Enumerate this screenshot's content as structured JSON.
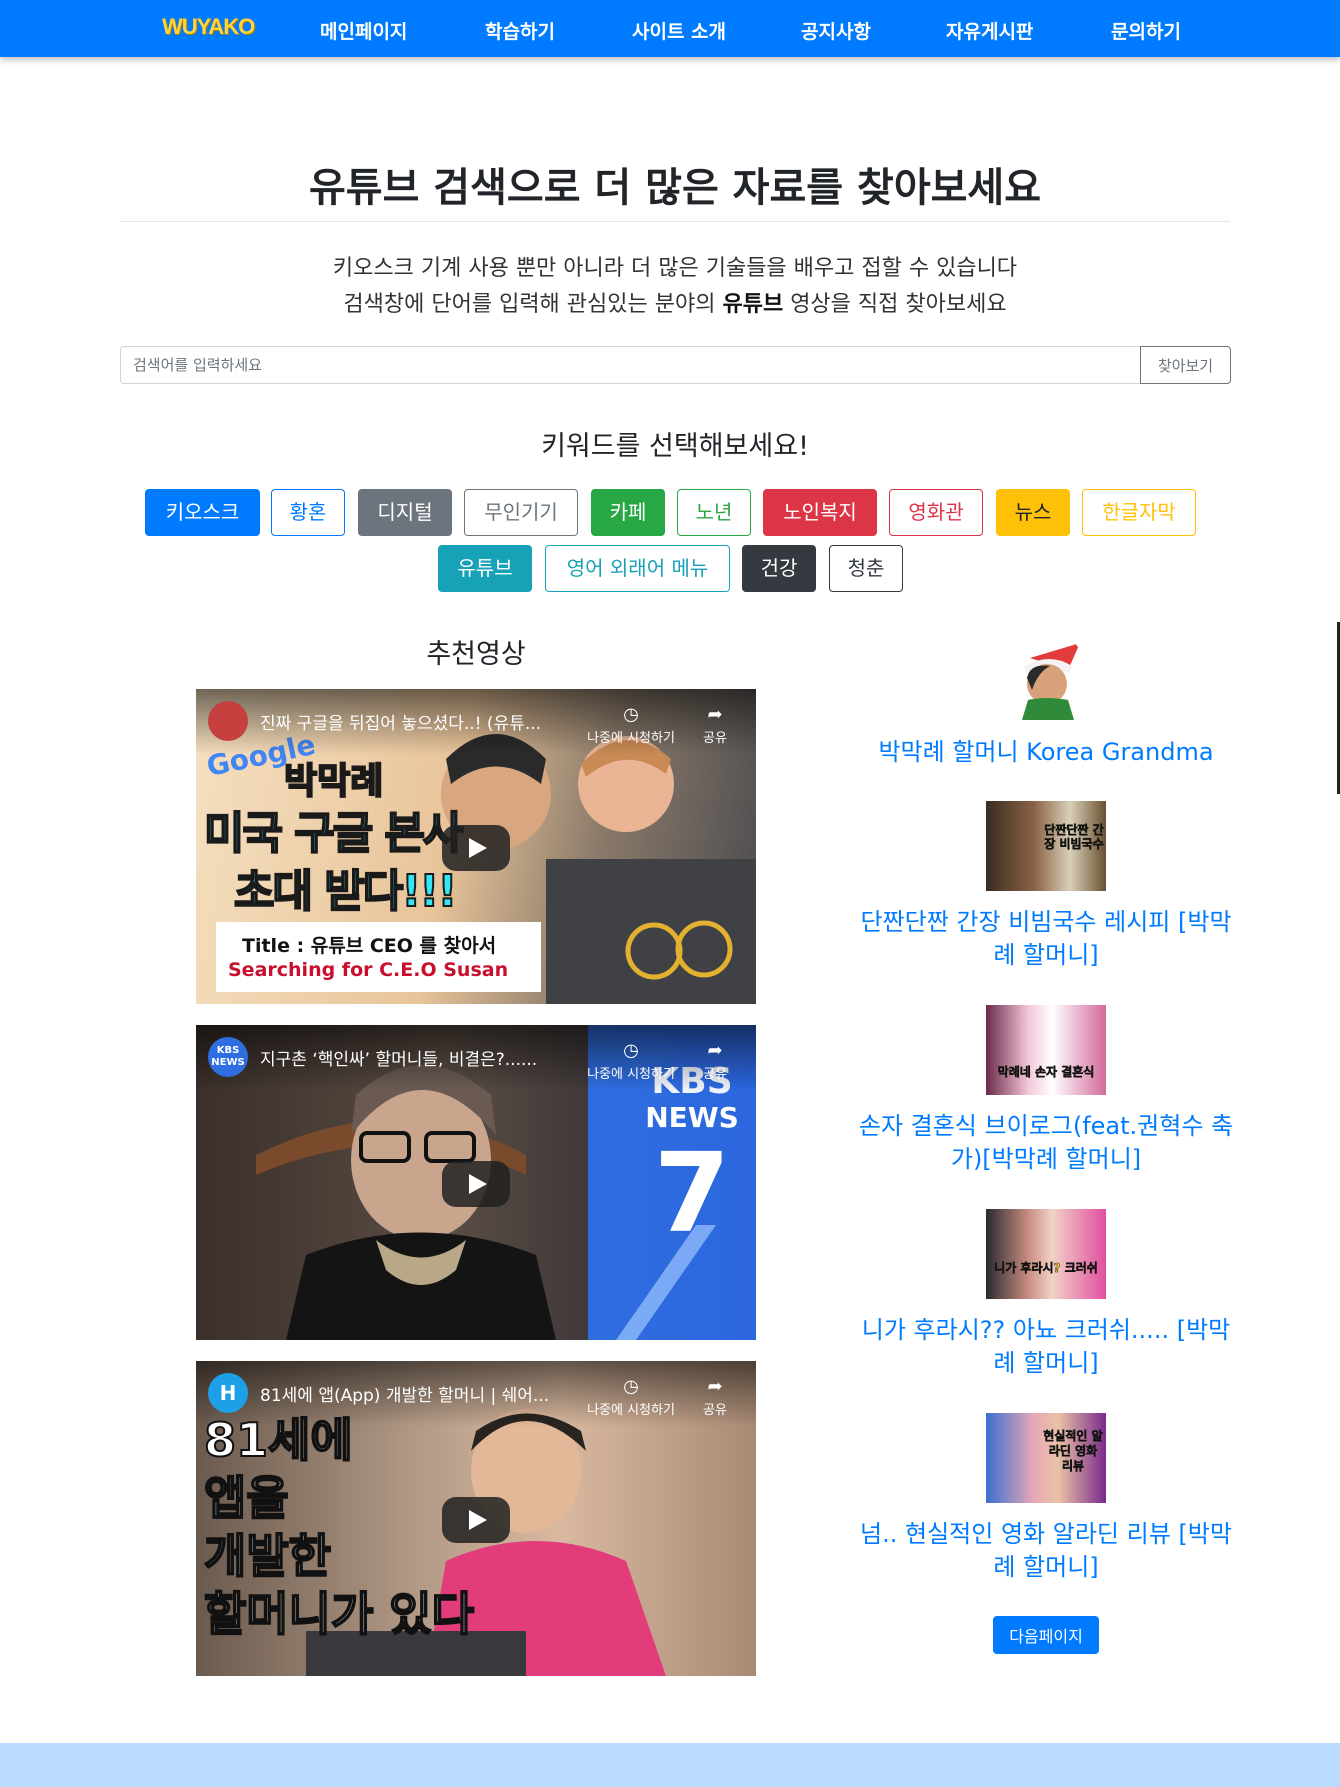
{
  "nav": {
    "brand": "WUYAKO",
    "items": [
      "메인페이지",
      "학습하기",
      "사이트 소개",
      "공지사항",
      "자유게시판",
      "문의하기"
    ]
  },
  "hero": {
    "title": "유튜브 검색으로 더 많은 자료를 찾아보세요",
    "line1": "키오스크 기계 사용 뿐만 아니라 더 많은 기술들을 배우고 접할 수 있습니다",
    "line2_before": "검색창에 단어를 입력해 관심있는 분야의 ",
    "line2_bold": "유튜브",
    "line2_after": " 영상을 직접 찾아보세요"
  },
  "search": {
    "placeholder": "검색어를 입력하세요",
    "value": "",
    "button": "찾아보기"
  },
  "keywords": {
    "title": "키워드를 선택해보세요!",
    "items": [
      "키오스크",
      "황혼",
      "디지털",
      "무인기기",
      "카페",
      "노년",
      "노인복지",
      "영화관",
      "뉴스",
      "한글자막",
      "유튜브",
      "영어 외래어 메뉴",
      "건강",
      "청춘"
    ]
  },
  "recommended": {
    "title": "추천영상",
    "watch_later": "나중에 시청하기",
    "share": "공유",
    "videos": [
      {
        "channel": "",
        "title": "진짜 구글을 뒤집어 놓으셨다..! (유튜...",
        "thumb_lines": [
          "박막례",
          "미국 구글 본사",
          "초대 받다!!!"
        ],
        "caption_title": "Title : 유튜브 CEO 를 찾아서",
        "caption_sub": "Searching for C.E.O Susan",
        "logo": "Google"
      },
      {
        "channel": "KBS NEWS",
        "title": "지구촌 ‘핵인싸’ 할머니들, 비결은?......",
        "thumb_lines": [
          "KBS",
          "NEWS",
          "7"
        ]
      },
      {
        "channel": "H",
        "title": "81세에 앱(App) 개발한 할머니 | 쉐어...",
        "thumb_lines": [
          "81세에",
          "앱을",
          "개발한",
          "할머니가 있다"
        ]
      }
    ]
  },
  "sidebar": {
    "channel_name": "박막례 할머니 Korea Grandma",
    "videos": [
      {
        "title": "단짠단짠 간장 비빔국수 레시피 [박막례 할머니]",
        "thumb_text": "단짠단짠 간장 비빔국수"
      },
      {
        "title": "손자 결혼식 브이로그(feat.권혁수 축가)[박막례 할머니]",
        "thumb_text": "막례네 손자 결혼식"
      },
      {
        "title": "니가 후라시?? 아뇨 크러쉬..... [박막례 할머니]",
        "thumb_text": "니가 후라시? 크러쉬"
      },
      {
        "title": "넘.. 현실적인 영화 알라딘 리뷰 [박막례 할머니]",
        "thumb_text": "현실적인 알라딘 영화 리뷰"
      }
    ],
    "next_button": "다음페이지"
  },
  "colors": {
    "primary": "#007bff",
    "footer": "#b9dbff",
    "brand": "#ffd43b"
  }
}
